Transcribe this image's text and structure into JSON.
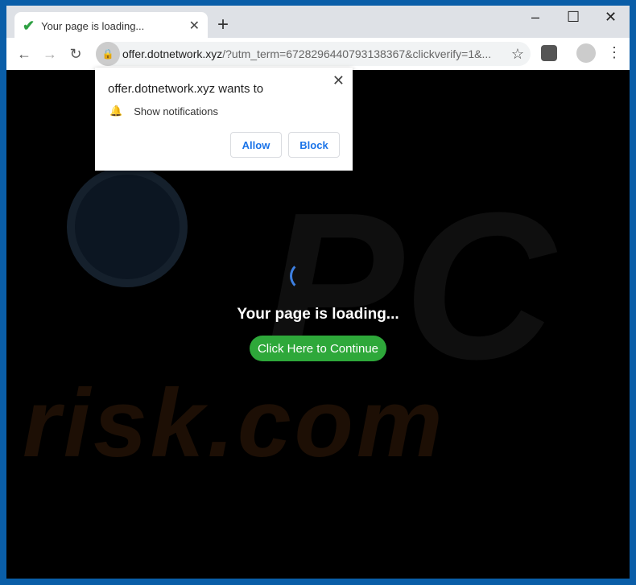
{
  "tab": {
    "title": "Your page is loading...",
    "icon": "checkmark-icon"
  },
  "omnibox": {
    "host": "offer.dotnetwork.xyz",
    "path": "/?utm_term=6728296440793138367&clickverify=1&..."
  },
  "page": {
    "heading": "Your page is loading...",
    "button": "Click Here to Continue",
    "watermark": "PC risk.com",
    "accent": "#2ea83a"
  },
  "popup": {
    "title": "offer.dotnetwork.xyz wants to",
    "permission": "Show notifications",
    "allow": "Allow",
    "block": "Block"
  }
}
